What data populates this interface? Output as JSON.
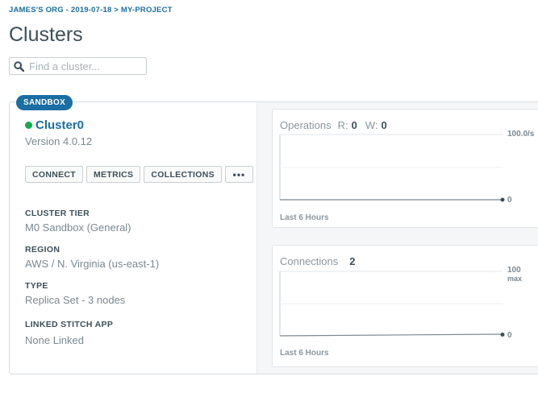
{
  "breadcrumb": "JAMES'S ORG - 2019-07-18 > MY-PROJECT",
  "page_title": "Clusters",
  "search": {
    "placeholder": "Find a cluster..."
  },
  "cluster": {
    "badge": "SANDBOX",
    "name": "Cluster0",
    "status_color": "#13aa52",
    "version": "Version 4.0.12",
    "buttons": {
      "connect": "CONNECT",
      "metrics": "METRICS",
      "collections": "COLLECTIONS",
      "more": "•••"
    },
    "fields": [
      {
        "label": "CLUSTER TIER",
        "value": "M0 Sandbox (General)"
      },
      {
        "label": "REGION",
        "value": "AWS / N. Virginia (us-east-1)"
      },
      {
        "label": "TYPE",
        "value": "Replica Set - 3 nodes"
      },
      {
        "label": "LINKED STITCH APP",
        "value": "None Linked"
      }
    ]
  },
  "metrics": {
    "operations": {
      "title": "Operations",
      "read_label": "R:",
      "read_value": "0",
      "write_label": "W:",
      "write_value": "0",
      "y_max_label": "100.0/s",
      "y_min_label": "0",
      "footer": "Last 6 Hours"
    },
    "connections": {
      "title": "Connections",
      "value": "2",
      "y_max_label": "100",
      "y_max_sublabel": "max",
      "y_min_label": "0",
      "footer": "Last 6 Hours"
    }
  },
  "colors": {
    "accent": "#1a6ea4",
    "status_ok": "#13aa52"
  }
}
